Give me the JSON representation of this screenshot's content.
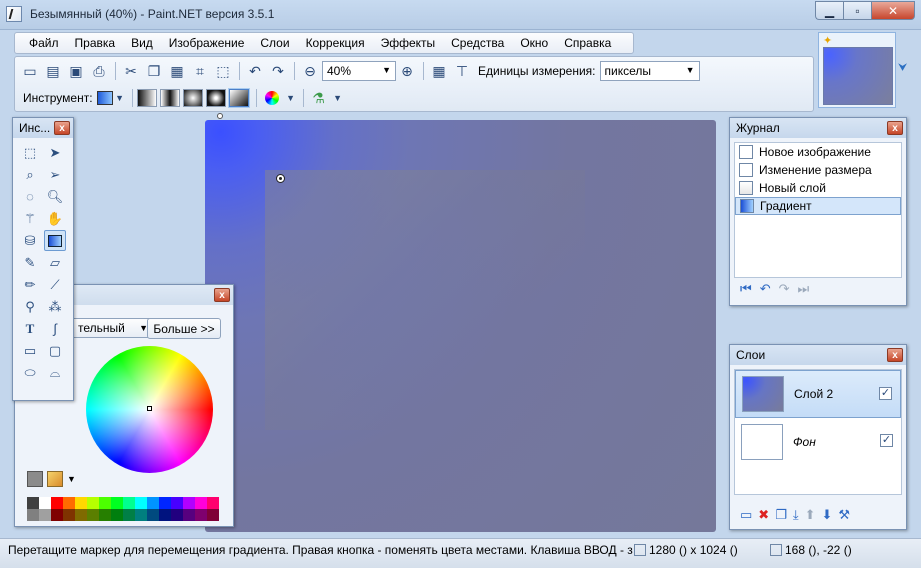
{
  "window": {
    "title": "Безымянный (40%) - Paint.NET версия 3.5.1",
    "min_glyph": "▁",
    "max_glyph": "▫",
    "close_glyph": "✕"
  },
  "menu": {
    "items": [
      "Файл",
      "Правка",
      "Вид",
      "Изображение",
      "Слои",
      "Коррекция",
      "Эффекты",
      "Средства",
      "Окно",
      "Справка"
    ]
  },
  "toolbar": {
    "zoom_value": "40%",
    "units_label": "Единицы измерения:",
    "units_value": "пикселы",
    "tool_label": "Инструмент:"
  },
  "tools_panel": {
    "title": "Инс...",
    "close_glyph": "x"
  },
  "palette": {
    "mode_label": "тельный",
    "more_button": "Больше >>",
    "close_glyph": "x",
    "swatches_top": [
      "#404040",
      "#ffffff",
      "#ff0000",
      "#ff6a00",
      "#ffd800",
      "#b6ff00",
      "#4cff00",
      "#00ff21",
      "#00ff90",
      "#00ffff",
      "#0094ff",
      "#0026ff",
      "#4800ff",
      "#b200ff",
      "#ff00dc",
      "#ff006e"
    ],
    "swatches_bottom": [
      "#808080",
      "#a0a0a0",
      "#7f0000",
      "#7f3300",
      "#7f6a00",
      "#5b7f00",
      "#267f00",
      "#007f0e",
      "#007f46",
      "#007f7f",
      "#004a7f",
      "#00137f",
      "#21007f",
      "#57007f",
      "#7f006e",
      "#7f0037"
    ]
  },
  "history": {
    "title": "Журнал",
    "close_glyph": "x",
    "items": [
      {
        "label": "Новое изображение",
        "selected": false
      },
      {
        "label": "Изменение размера",
        "selected": false
      },
      {
        "label": "Новый слой",
        "selected": false
      },
      {
        "label": "Градиент",
        "selected": true
      }
    ]
  },
  "layers": {
    "title": "Слои",
    "close_glyph": "x",
    "items": [
      {
        "name": "Слой 2",
        "visible": true,
        "selected": true
      },
      {
        "name": "Фон",
        "visible": true,
        "selected": false
      }
    ],
    "check_glyph": "✓"
  },
  "status": {
    "message": "Перетащите маркер для перемещения градиента. Правая кнопка - поменять цвета местами. Клавиша ВВОД - з",
    "size": "1280 () x 1024 ()",
    "position": "168 (), -22 ()"
  },
  "colors": {
    "primary": "#2b43ff",
    "secondary": "#7a7ea0"
  }
}
